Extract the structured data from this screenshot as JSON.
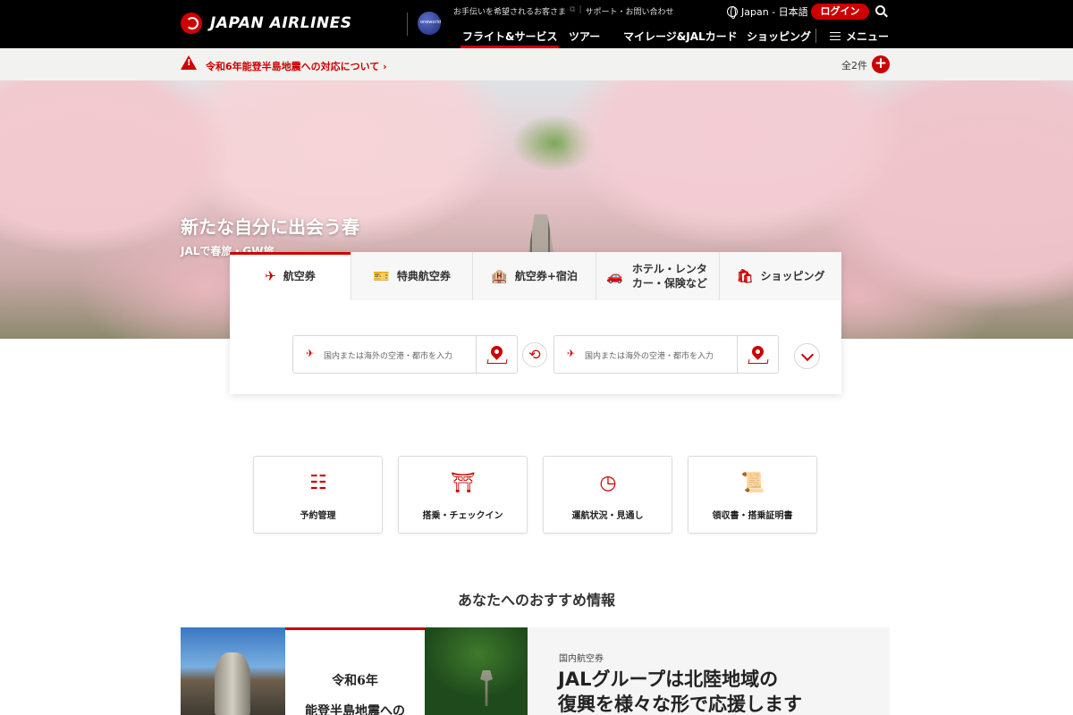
{
  "header": {
    "logo_text": "JAPAN AIRLINES",
    "oneworld_label": "oneworld",
    "util_links": [
      "お手伝いを希望されるお客さま",
      "サポート・お問い合わせ"
    ],
    "lang": "Japan - 日本語",
    "login": "ログイン",
    "nav": [
      "フライト&サービス",
      "ツアー",
      "マイレージ&JALカード",
      "ショッピング"
    ],
    "menu": "メニュー"
  },
  "notice": {
    "text": "令和6年能登半島地震への対応について",
    "count": "全2件",
    "plus": "+"
  },
  "hero": {
    "title": "新たな自分に出会う春",
    "subtitle": "JALで春旅・GW旅"
  },
  "booking": {
    "tabs": [
      {
        "label": "航空券",
        "icon": "plane-icon"
      },
      {
        "label": "特典航空券",
        "icon": "ticket-icon"
      },
      {
        "label": "航空券+宿泊",
        "icon": "plane-hotel-icon"
      },
      {
        "label": "ホテル・レンタカー・保険など",
        "icon": "hotel-car-icon"
      },
      {
        "label": "ショッピング",
        "icon": "shopping-bag-icon"
      }
    ],
    "origin_placeholder": "国内または海外の空港・都市を入力",
    "destination_placeholder": "国内または海外の空港・都市を入力"
  },
  "quick_links": [
    {
      "label": "予約管理",
      "icon": "checklist-icon"
    },
    {
      "label": "搭乗・チェックイン",
      "icon": "boarding-gate-icon"
    },
    {
      "label": "運航状況・見通し",
      "icon": "clock-icon"
    },
    {
      "label": "領収書・搭乗証明書",
      "icon": "receipt-icon"
    }
  ],
  "recommend": {
    "title": "あなたへのおすすめ情報",
    "feature": {
      "image_line1": "令和6年",
      "image_line2": "能登半島地震への",
      "category": "国内航空券",
      "headline_line1": "JALグループは北陸地域の",
      "headline_line2": "復興を様々な形で応援します"
    }
  },
  "colors": {
    "brand_red": "#cc0000",
    "header_bg": "#000000",
    "notice_bg": "#f2f2f0"
  }
}
